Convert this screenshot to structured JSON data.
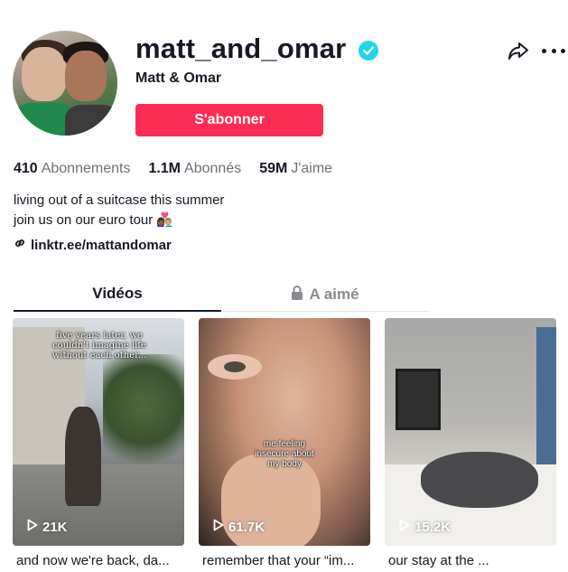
{
  "profile": {
    "username": "matt_and_omar",
    "display_name": "Matt & Omar",
    "subscribe_label": "S'abonner",
    "verified_color": "#20d5ec"
  },
  "stats": [
    {
      "value": "410",
      "label": "Abonnements"
    },
    {
      "value": "1.1M",
      "label": "Abonnés"
    },
    {
      "value": "59M",
      "label": "J'aime"
    }
  ],
  "bio": {
    "line1": "living out of a suitcase this summer",
    "line2": "join us on our euro tour 👩🏾‍❤️‍👨🏼",
    "link": "linktr.ee/mattandomar"
  },
  "tabs": [
    {
      "label": "Vidéos",
      "active": true
    },
    {
      "label": "A aimé",
      "active": false,
      "icon": "lock-icon"
    }
  ],
  "videos": [
    {
      "views": "21K",
      "overlay": "five years later, we couldn't imagine life without each other...",
      "caption": "and now we're back, da..."
    },
    {
      "views": "61.7K",
      "overlay": "me feeling insecure about my body",
      "caption": "remember that your “im..."
    },
    {
      "views": "15.2K",
      "overlay": "",
      "caption": "our stay at the ..."
    }
  ],
  "colors": {
    "accent": "#fe2c55",
    "text": "#161823",
    "muted": "#6e6f76"
  }
}
